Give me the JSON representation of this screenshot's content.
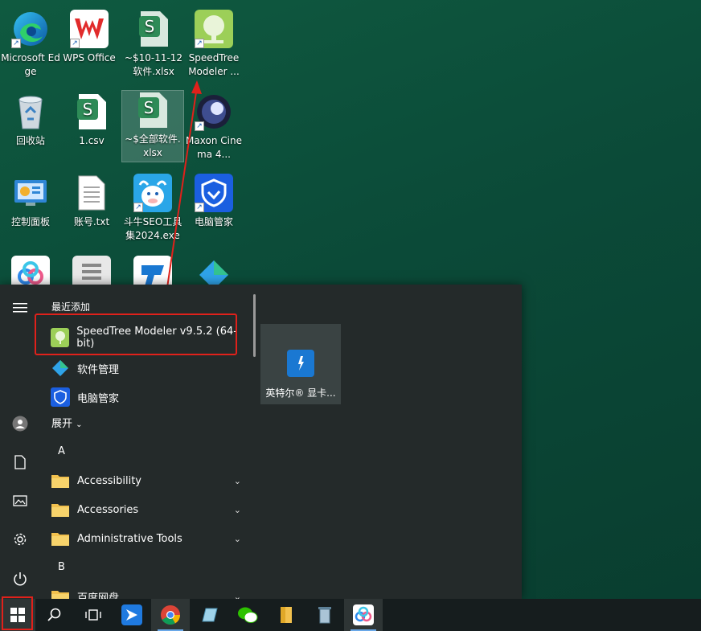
{
  "desktop": {
    "icons": [
      {
        "label": "Microsoft Edge",
        "icon": "edge-icon"
      },
      {
        "label": "WPS Office",
        "icon": "wps-icon"
      },
      {
        "label": "~$10-11-12软件.xlsx",
        "icon": "spreadsheet-icon"
      },
      {
        "label": "SpeedTree Modeler ...",
        "icon": "speedtree-icon"
      },
      {
        "label": "回收站",
        "icon": "recycle-bin-icon"
      },
      {
        "label": "1.csv",
        "icon": "csv-icon"
      },
      {
        "label": "~$全部软件.xlsx",
        "icon": "spreadsheet-icon"
      },
      {
        "label": "Maxon Cinema 4...",
        "icon": "cinema4d-icon"
      },
      {
        "label": "控制面板",
        "icon": "control-panel-icon"
      },
      {
        "label": "账号.txt",
        "icon": "text-file-icon"
      },
      {
        "label": "斗牛SEO工具集2024.exe",
        "icon": "douniu-icon"
      },
      {
        "label": "电脑管家",
        "icon": "pc-manager-icon"
      }
    ]
  },
  "start_menu": {
    "recent_header": "最近添加",
    "recent_apps": [
      {
        "label": "SpeedTree Modeler v9.5.2 (64-bit)",
        "icon": "speedtree-icon"
      },
      {
        "label": "软件管理",
        "icon": "software-manager-icon"
      },
      {
        "label": "电脑管家",
        "icon": "pc-manager-icon"
      }
    ],
    "expand_label": "展开",
    "letter_a": "A",
    "letter_b": "B",
    "folders": [
      {
        "label": "Accessibility"
      },
      {
        "label": "Accessories"
      },
      {
        "label": "Administrative Tools"
      },
      {
        "label": "百度网盘"
      }
    ],
    "tile_label": "英特尔® 显卡..."
  },
  "taskbar": {
    "items": [
      "start-icon",
      "search-icon",
      "task-view-icon",
      "feishu-icon",
      "chrome-icon",
      "notes-icon",
      "wechat-icon",
      "file-explorer-icon",
      "recycle-icon",
      "baidu-netdisk-icon"
    ]
  },
  "colors": {
    "highlight": "#e0211b",
    "menu_bg": "#242a2a",
    "taskbar_bg": "#161d1e"
  }
}
